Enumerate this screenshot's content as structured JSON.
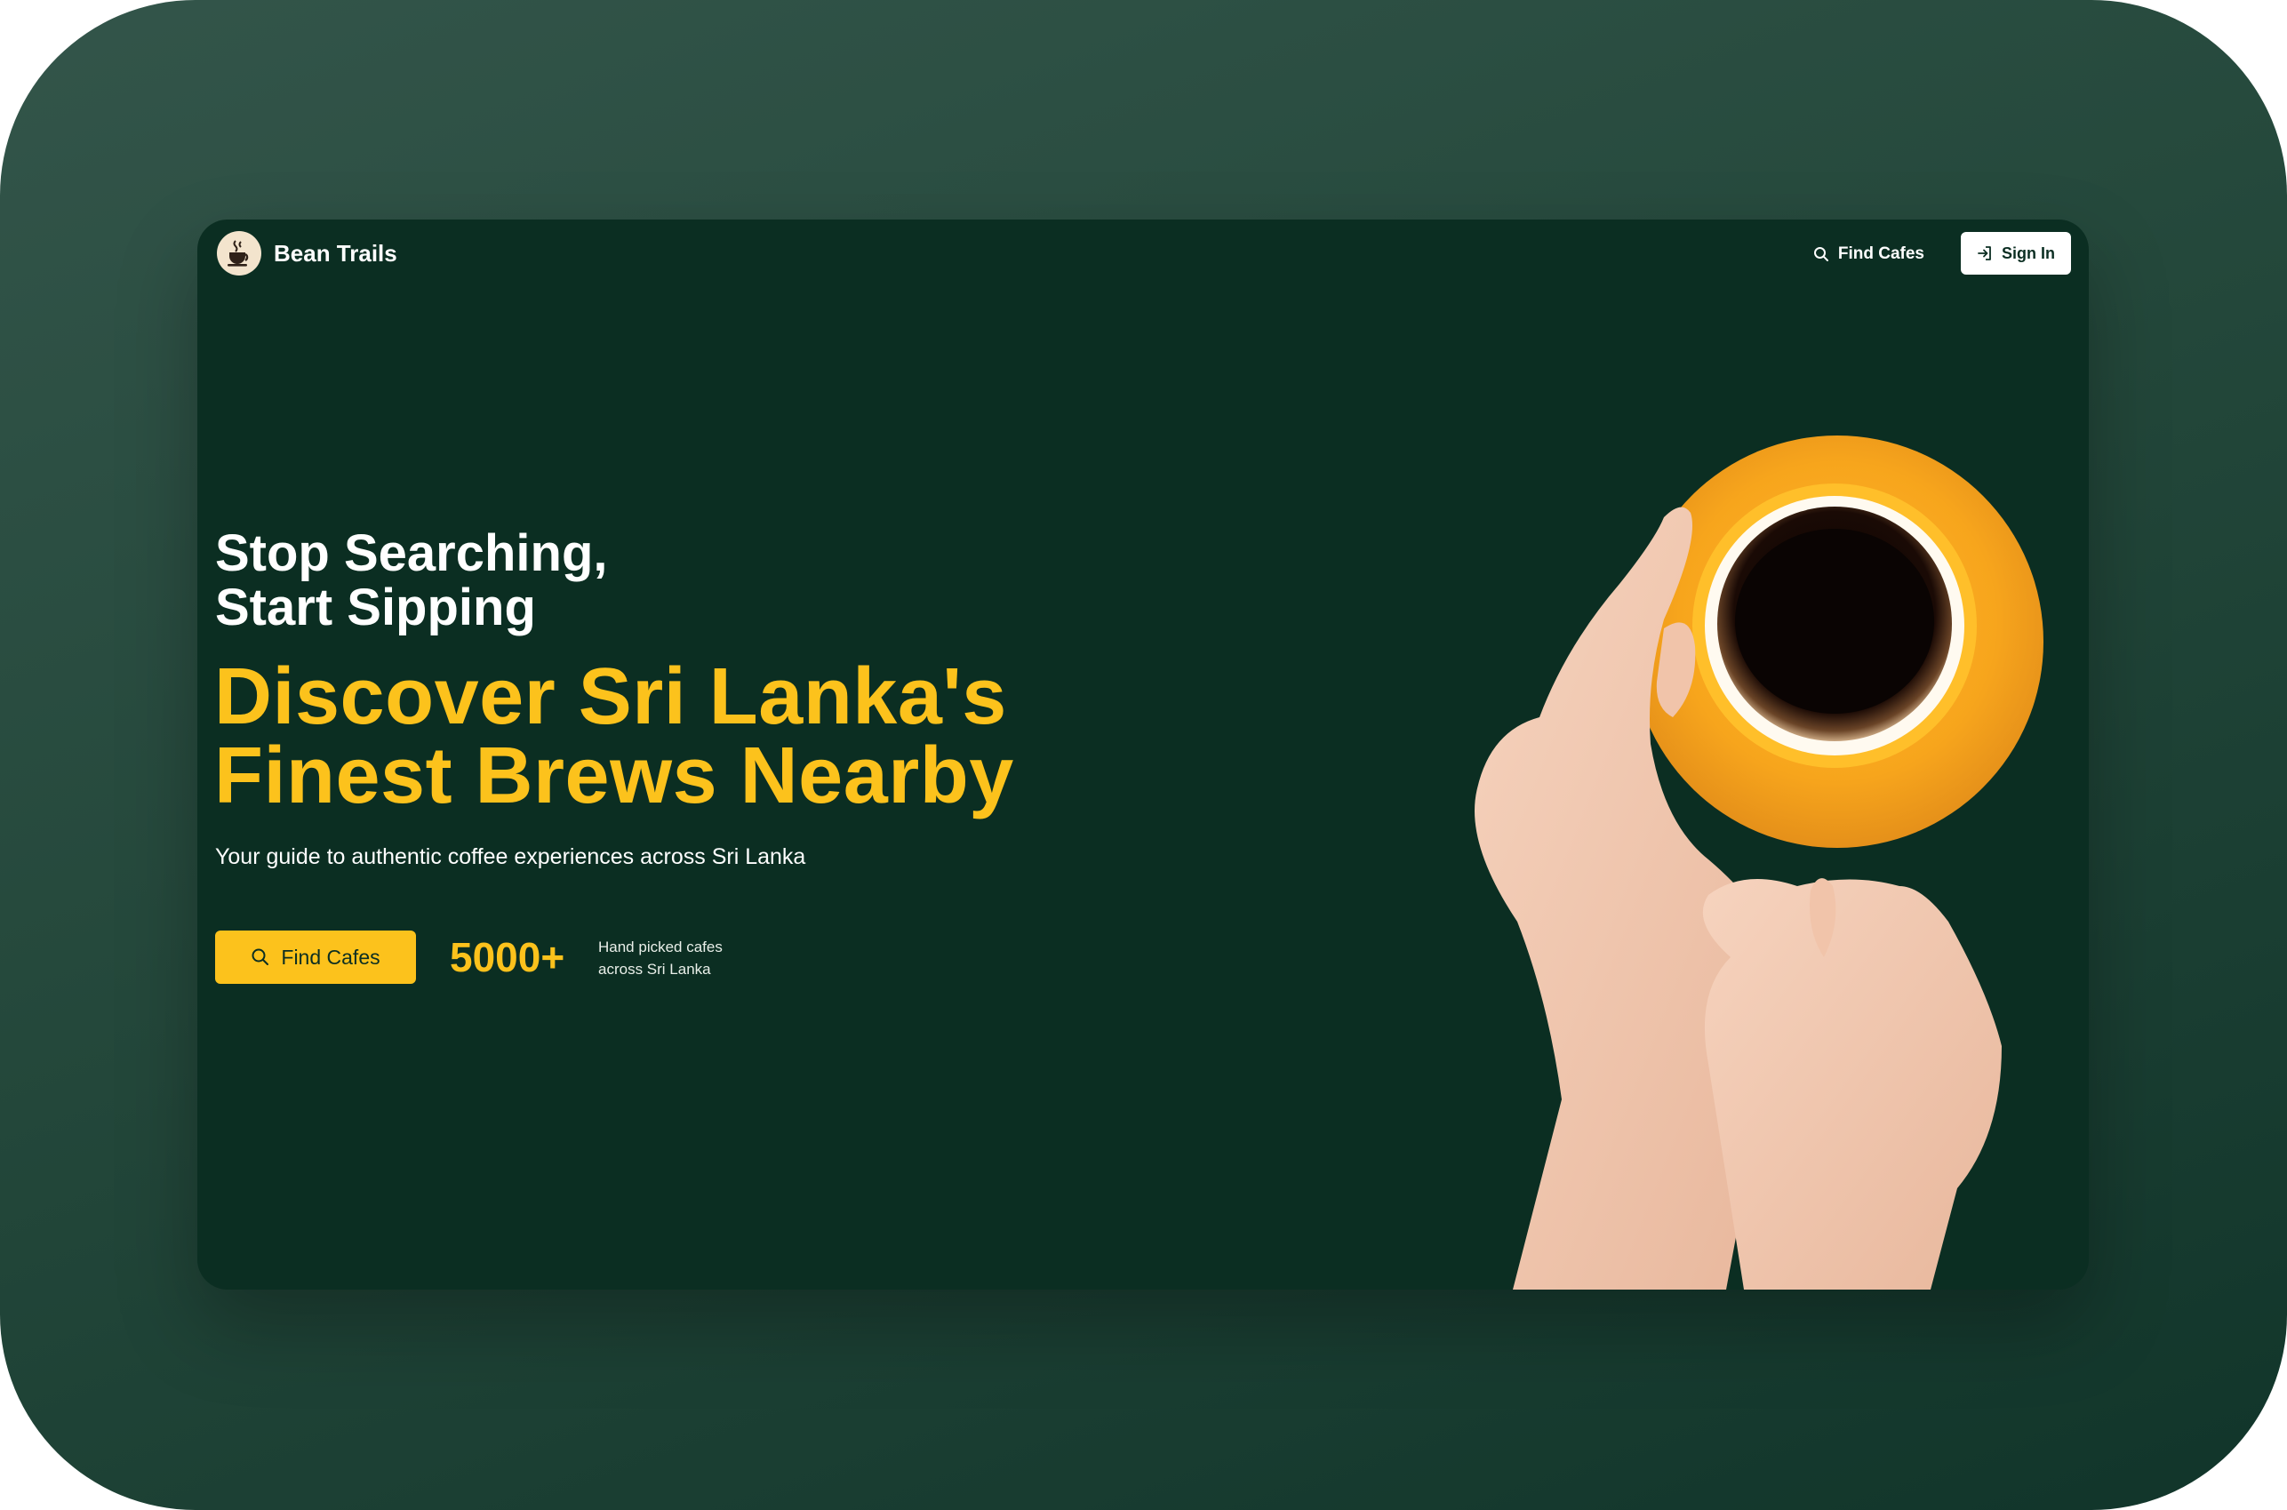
{
  "brand": {
    "name": "Bean Trails",
    "logo_icon": "coffee-cup-icon"
  },
  "nav": {
    "find_label": "Find Cafes",
    "find_icon": "search-icon",
    "signin_label": "Sign In",
    "signin_icon": "sign-in-icon"
  },
  "hero": {
    "kicker_line1": "Stop Searching,",
    "kicker_line2": "Start Sipping",
    "headline_line1": "Discover Sri Lanka's",
    "headline_line2": "Finest Brews Nearby",
    "subtitle": "Your guide to authentic coffee experiences across Sri Lanka",
    "cta_label": "Find Cafes",
    "stat_value": "5000+",
    "stat_label_line1": "Hand picked cafes",
    "stat_label_line2": "across Sri Lanka"
  },
  "colors": {
    "background": "#0b2e22",
    "accent": "#fcc21c",
    "text": "#ffffff"
  }
}
